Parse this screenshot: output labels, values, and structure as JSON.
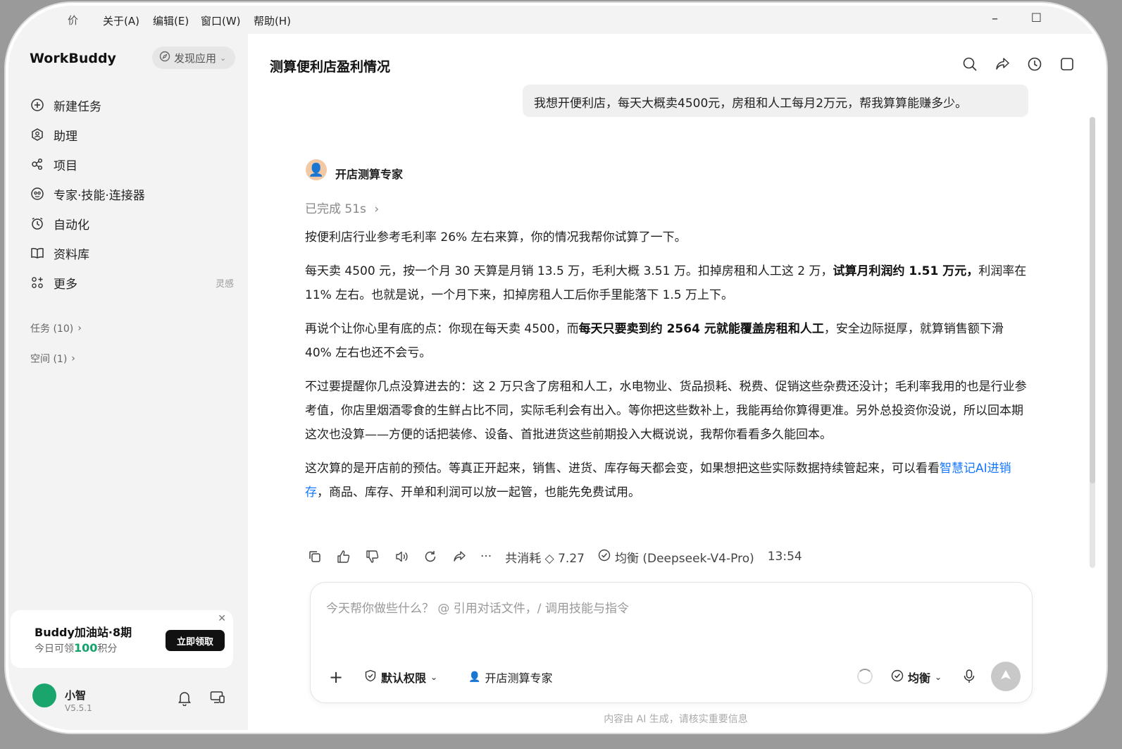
{
  "menubar": {
    "app_cut": "价",
    "items": [
      "关于(A)",
      "编辑(E)",
      "窗口(W)",
      "帮助(H)"
    ],
    "minimize": "–",
    "maximize": "□"
  },
  "sidebar": {
    "brand": "WorkBuddy",
    "discover": "发现应用",
    "nav": [
      {
        "label": "新建任务",
        "icon": "plus-circle-icon"
      },
      {
        "label": "助理",
        "icon": "assistant-icon"
      },
      {
        "label": "项目",
        "icon": "project-icon"
      },
      {
        "label": "专家·技能·连接器",
        "icon": "expert-icon"
      },
      {
        "label": "自动化",
        "icon": "automation-icon"
      },
      {
        "label": "资料库",
        "icon": "library-icon"
      },
      {
        "label": "更多",
        "icon": "more-grid-icon",
        "hint": "灵感"
      }
    ],
    "tasks": "任务 (10)",
    "spaces": "空间 (1)",
    "promo": {
      "title": "Buddy加油站·8期",
      "sub_prefix": "今日可领",
      "sub_num": "100",
      "sub_suffix": "积分",
      "button": "立即领取"
    },
    "user": {
      "name": "小智",
      "version": "V5.5.1"
    }
  },
  "main": {
    "title": "测算便利店盈利情况",
    "user_message": "我想开便利店，每天大概卖4500元，房租和人工每月2万元，帮我算算能赚多少。",
    "agent_name": "开店测算专家",
    "done": "已完成 51s",
    "answer": {
      "p1": "按便利店行业参考毛利率 26% 左右来算，你的情况我帮你试算了一下。",
      "p2a": "每天卖 4500 元，按一个月 30 天算是月销 13.5 万，毛利大概 3.51 万。扣掉房租和人工这 2 万，",
      "p2b": "试算月利润约 1.51 万元，",
      "p2c": "利润率在 11% 左右。也就是说，一个月下来，扣掉房租人工后你手里能落下 1.5 万上下。",
      "p3a": "再说个让你心里有底的点：你现在每天卖 4500，而",
      "p3b": "每天只要卖到约 2564 元就能覆盖房租和人工",
      "p3c": "，安全边际挺厚，就算销售额下滑 40% 左右也还不会亏。",
      "p4": "不过要提醒你几点没算进去的：这 2 万只含了房租和人工，水电物业、货品损耗、税费、促销这些杂费还没计；毛利率我用的也是行业参考值，你店里烟酒零食的生鲜占比不同，实际毛利会有出入。等你把这些数补上，我能再给你算得更准。另外总投资你没说，所以回本期这次也没算——方便的话把装修、设备、首批进货这些前期投入大概说说，我帮你看看多久能回本。",
      "p5a": "这次算的是开店前的预估。等真正开起来，销售、进货、库存每天都会变，如果想把这些实际数据持续管起来，可以看看",
      "p5_link": "智慧记AI进销存",
      "p5b": "，商品、库存、开单和利润可以放一起管，也能先免费试用。"
    },
    "meta": {
      "cost": "共消耗 ◇ 7.27",
      "model": "均衡 (Deepseek-V4-Pro)",
      "time": "13:54",
      "more": "···"
    },
    "composer": {
      "placeholder": "今天帮你做些什么？  @ 引用对话文件，/ 调用技能与指令",
      "permission": "默认权限",
      "expert": "开店测算专家",
      "mode": "均衡"
    },
    "disclaimer": "内容由 AI 生成，请核实重要信息"
  },
  "colors": {
    "accent_link": "#1677ff",
    "points_green": "#14a36b",
    "sidebar_bg": "#f3f3f3"
  }
}
